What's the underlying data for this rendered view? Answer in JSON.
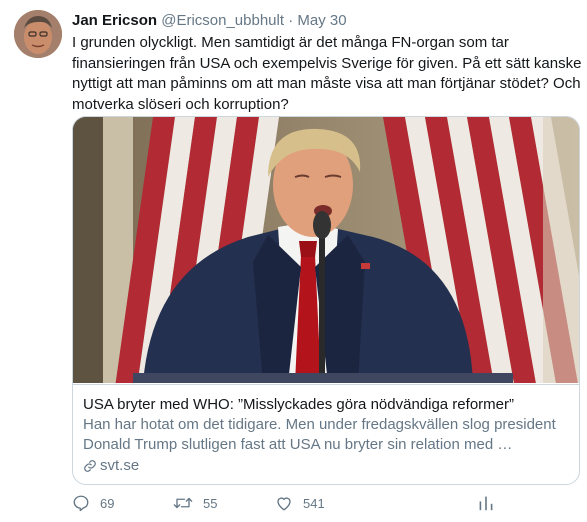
{
  "tweet": {
    "author_name": "Jan Ericson",
    "handle": "@Ericson_ubbhult",
    "separator": "·",
    "date": "May 30",
    "text": "I grunden olyckligt. Men samtidigt är det många FN-organ som tar finansieringen från USA och exempelvis Sverige för given. På ett sätt kanske nyttigt att man påminns om att man måste visa att man förtjänar stödet? Och motverka slöseri och korruption?",
    "card": {
      "title": "USA bryter med WHO: ”Misslyckades göra nödvändiga reformer”",
      "description": "Han har hotat om det tidigare. Men under fredagskvällen slog president Donald Trump slutligen fast att USA nu bryter sin relation med …",
      "domain": "svt.se"
    },
    "actions": {
      "reply_count": "69",
      "retweet_count": "55",
      "like_count": "541"
    },
    "icons": {
      "reply": "reply-icon",
      "retweet": "retweet-icon",
      "like": "heart-icon",
      "analytics": "analytics-icon",
      "link": "link-icon"
    },
    "colors": {
      "text": "#14171a",
      "secondary": "#657786",
      "border": "#ccd6dd"
    }
  }
}
